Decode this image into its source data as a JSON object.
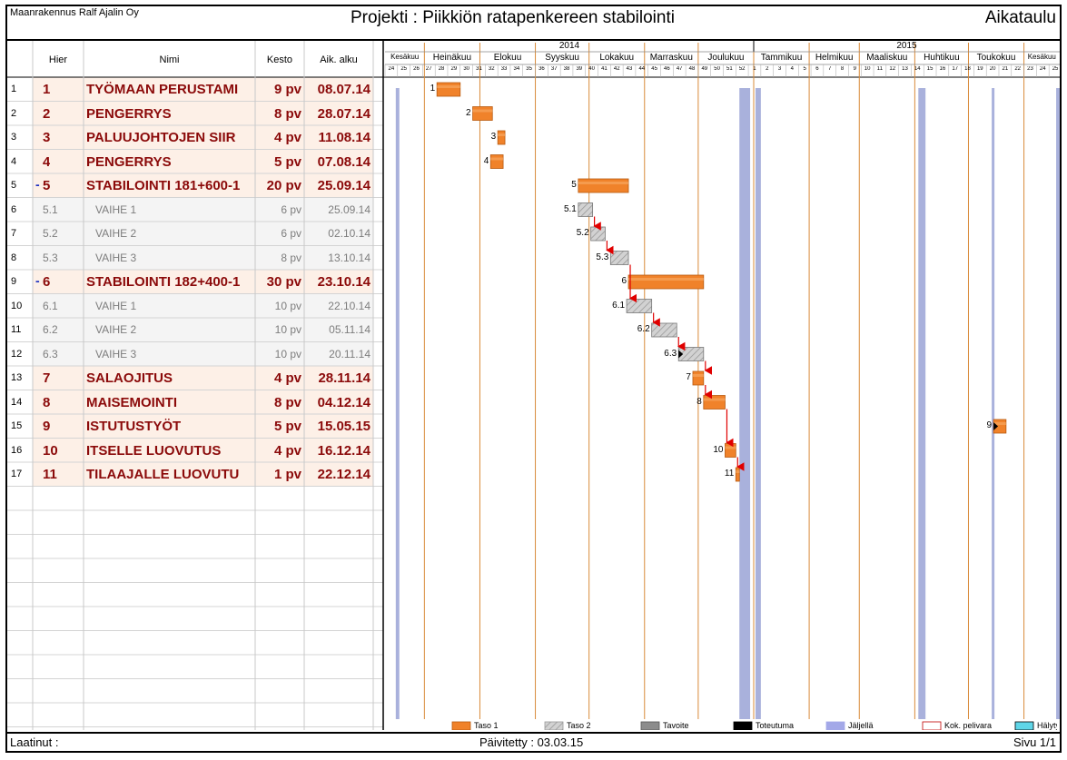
{
  "header": {
    "company": "Maanrakennus Ralf Ajalin Oy",
    "title": "Projekti : Piikkiön ratapenkereen stabilointi",
    "right_title": "Aikataulu"
  },
  "footer": {
    "author_label": "Laatinut :",
    "updated_label": "Päivitetty : 03.03.15",
    "page_label": "Sivu 1/1"
  },
  "table": {
    "columns": [
      "Hier",
      "Nimi",
      "Kesto",
      "Aik. alku"
    ]
  },
  "timeline": {
    "years": [
      "2014",
      "2015"
    ],
    "months": [
      "Kesäkuu",
      "Heinäkuu",
      "Elokuu",
      "Syyskuu",
      "Lokakuu",
      "Marraskuu",
      "Joulukuu",
      "Tammikuu",
      "Helmikuu",
      "Maaliskuu",
      "Huhtikuu",
      "Toukokuu",
      "Kesäkuu"
    ],
    "weeks": [
      "24",
      "25",
      "26",
      "27",
      "28",
      "29",
      "30",
      "31",
      "32",
      "33",
      "34",
      "35",
      "36",
      "37",
      "38",
      "39",
      "40",
      "41",
      "42",
      "43",
      "44",
      "45",
      "46",
      "47",
      "48",
      "49",
      "50",
      "51",
      "52",
      "1",
      "2",
      "3",
      "4",
      "5",
      "6",
      "7",
      "8",
      "9",
      "10",
      "11",
      "12",
      "13",
      "14",
      "15",
      "16",
      "17",
      "18",
      "19",
      "20",
      "21",
      "22",
      "23",
      "24",
      "25"
    ]
  },
  "legend": [
    "Taso 1",
    "Taso 2",
    "Tavoite",
    "Toteutuma",
    "Jäljellä",
    "Kok. pelivara",
    "Hälytys"
  ],
  "chart_data": {
    "type": "gantt",
    "title": "Projekti : Piikkiön ratapenkereen stabilointi",
    "tasks": [
      {
        "row": "1",
        "hier": "1",
        "name": "TYÖMAAN PERUSTAMI",
        "duration": "9 pv",
        "start": "08.07.14",
        "level": 1,
        "bar_label": "1",
        "start_date": "2014-07-08",
        "end_date": "2014-07-21"
      },
      {
        "row": "2",
        "hier": "2",
        "name": "PENGERRYS",
        "duration": "8 pv",
        "start": "28.07.14",
        "level": 1,
        "bar_label": "2",
        "start_date": "2014-07-28",
        "end_date": "2014-08-08"
      },
      {
        "row": "3",
        "hier": "3",
        "name": "PALUUJOHTOJEN SIIR",
        "duration": "4 pv",
        "start": "11.08.14",
        "level": 1,
        "bar_label": "3",
        "start_date": "2014-08-11",
        "end_date": "2014-08-15"
      },
      {
        "row": "4",
        "hier": "4",
        "name": "PENGERRYS",
        "duration": "5 pv",
        "start": "07.08.14",
        "level": 1,
        "bar_label": "4",
        "start_date": "2014-08-07",
        "end_date": "2014-08-14"
      },
      {
        "row": "5",
        "hier": "5",
        "name": "STABILOINTI 181+600-1",
        "duration": "20 pv",
        "start": "25.09.14",
        "level": 1,
        "bar_label": "5",
        "summary": true,
        "start_date": "2014-09-25",
        "end_date": "2014-10-23"
      },
      {
        "row": "6",
        "hier": "5.1",
        "name": "VAIHE 1",
        "duration": "6 pv",
        "start": "25.09.14",
        "level": 2,
        "bar_label": "5.1",
        "start_date": "2014-09-25",
        "end_date": "2014-10-03"
      },
      {
        "row": "7",
        "hier": "5.2",
        "name": "VAIHE 2",
        "duration": "6 pv",
        "start": "02.10.14",
        "level": 2,
        "bar_label": "5.2",
        "start_date": "2014-10-02",
        "end_date": "2014-10-10"
      },
      {
        "row": "8",
        "hier": "5.3",
        "name": "VAIHE 3",
        "duration": "8 pv",
        "start": "13.10.14",
        "level": 2,
        "bar_label": "5.3",
        "start_date": "2014-10-13",
        "end_date": "2014-10-23"
      },
      {
        "row": "9",
        "hier": "6",
        "name": "STABILOINTI 182+400-1",
        "duration": "30 pv",
        "start": "23.10.14",
        "level": 1,
        "bar_label": "6",
        "summary": true,
        "start_date": "2014-10-23",
        "end_date": "2014-12-04"
      },
      {
        "row": "10",
        "hier": "6.1",
        "name": "VAIHE 1",
        "duration": "10 pv",
        "start": "22.10.14",
        "level": 2,
        "bar_label": "6.1",
        "start_date": "2014-10-22",
        "end_date": "2014-11-05"
      },
      {
        "row": "11",
        "hier": "6.2",
        "name": "VAIHE 2",
        "duration": "10 pv",
        "start": "05.11.14",
        "level": 2,
        "bar_label": "6.2",
        "start_date": "2014-11-05",
        "end_date": "2014-11-19"
      },
      {
        "row": "12",
        "hier": "6.3",
        "name": "VAIHE 3",
        "duration": "10 pv",
        "start": "20.11.14",
        "level": 2,
        "bar_label": "6.3",
        "start_date": "2014-11-20",
        "end_date": "2014-12-04"
      },
      {
        "row": "13",
        "hier": "7",
        "name": "SALAOJITUS",
        "duration": "4 pv",
        "start": "28.11.14",
        "level": 1,
        "bar_label": "7",
        "start_date": "2014-11-28",
        "end_date": "2014-12-04"
      },
      {
        "row": "14",
        "hier": "8",
        "name": "MAISEMOINTI",
        "duration": "8 pv",
        "start": "04.12.14",
        "level": 1,
        "bar_label": "8",
        "start_date": "2014-12-04",
        "end_date": "2014-12-16"
      },
      {
        "row": "15",
        "hier": "9",
        "name": "ISTUTUSTYÖT",
        "duration": "5 pv",
        "start": "15.05.15",
        "level": 1,
        "bar_label": "9",
        "start_date": "2015-05-15",
        "end_date": "2015-05-22"
      },
      {
        "row": "16",
        "hier": "10",
        "name": "ITSELLE LUOVUTUS",
        "duration": "4 pv",
        "start": "16.12.14",
        "level": 1,
        "bar_label": "10",
        "start_date": "2014-12-16",
        "end_date": "2014-12-22"
      },
      {
        "row": "17",
        "hier": "11",
        "name": "TILAAJALLE LUOVUTU",
        "duration": "1 pv",
        "start": "22.12.14",
        "level": 1,
        "bar_label": "11",
        "start_date": "2014-12-22",
        "end_date": "2014-12-23"
      }
    ],
    "dependencies": [
      [
        "5.1",
        "5.2"
      ],
      [
        "5.2",
        "5.3"
      ],
      [
        "5.3",
        "6.1"
      ],
      [
        "6.1",
        "6.2"
      ],
      [
        "6.2",
        "6.3"
      ],
      [
        "6.3",
        "7"
      ],
      [
        "7",
        "8"
      ],
      [
        "8",
        "10"
      ],
      [
        "10",
        "11"
      ]
    ],
    "x_range": [
      "2014-06-09",
      "2015-06-21"
    ]
  },
  "colors": {
    "level1_bar": "#f0822a",
    "level1_row_bg": "#fdf0e7",
    "level1_text": "#8b0a0a",
    "level2_bar": "#c8c8c8",
    "level2_row_bg": "#f4f4f4",
    "dependency_arrow": "#e00000",
    "month_line": "#d98b3a",
    "week_band": "#9aa3d6"
  }
}
